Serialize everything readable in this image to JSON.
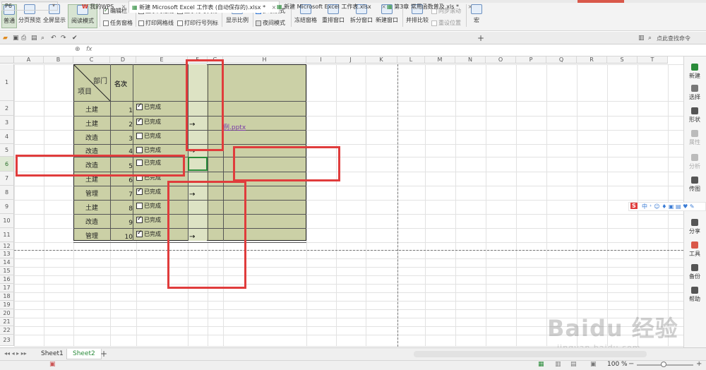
{
  "ribbon": {
    "buttons": {
      "normal": "普通",
      "page_preview": "分页预览",
      "fullscreen": "全屏显示",
      "read_mode": "阅读模式",
      "show_ratio": "显示比例",
      "freeze": "冻结窗格",
      "rearrange": "重排窗口",
      "split": "拆分窗口",
      "new_window": "新建窗口",
      "side_by_side": "并排比较",
      "macro": "宏"
    },
    "checks": {
      "edit_bar": {
        "label": "编辑栏",
        "checked": true
      },
      "task_pane": {
        "label": "任务窗格",
        "checked": false
      },
      "gridlines": {
        "label": "显示网格线",
        "checked": true
      },
      "print_gridlines": {
        "label": "打印网格线",
        "checked": false
      },
      "headers": {
        "label": "显示行号列标",
        "checked": true
      },
      "print_headers": {
        "label": "打印行号列标",
        "checked": false
      }
    },
    "eye_mode": "护眼模式",
    "night_mode": "夜间模式",
    "sync_scroll": "同步滚动",
    "reset_pos": "重设位置"
  },
  "tabs": {
    "my_wps": "我的WPS",
    "doc1": "新建 Microsoft Excel 工作表 (自动保存的).xlsx *",
    "doc2": "新建 Microsoft Excel 工作表.xlsx",
    "doc3": "第3章 常用函数普及.xls *",
    "search_hint": "点此查找命令"
  },
  "formula": {
    "cell": "P6",
    "fx": "fx"
  },
  "columns": [
    "A",
    "B",
    "C",
    "D",
    "E",
    "F",
    "G",
    "H",
    "I",
    "J",
    "K",
    "L",
    "M",
    "N",
    "O",
    "P",
    "Q",
    "R",
    "S",
    "T"
  ],
  "rows": [
    "1",
    "2",
    "3",
    "4",
    "5",
    "6",
    "7",
    "8",
    "9",
    "10",
    "11",
    "12",
    "13",
    "14",
    "15",
    "16",
    "17",
    "18",
    "19",
    "20",
    "21",
    "22",
    "23"
  ],
  "table": {
    "header_dept": "部门",
    "header_item": "项目",
    "header_rank": "名次",
    "rows": [
      {
        "project": "土建",
        "rank": "1",
        "status": "已完成",
        "done": true,
        "arrow": ""
      },
      {
        "project": "土建",
        "rank": "2",
        "status": "已完成",
        "done": true,
        "arrow": "→"
      },
      {
        "project": "改造",
        "rank": "3",
        "status": "已完成",
        "done": false,
        "arrow": ""
      },
      {
        "project": "改造",
        "rank": "4",
        "status": "已完成",
        "done": false,
        "arrow": "→"
      },
      {
        "project": "改造",
        "rank": "5",
        "status": "已完成",
        "done": false,
        "arrow": ""
      },
      {
        "project": "土建",
        "rank": "6",
        "status": "已完成",
        "done": false,
        "arrow": ""
      },
      {
        "project": "管理",
        "rank": "7",
        "status": "已完成",
        "done": true,
        "arrow": "→"
      },
      {
        "project": "土建",
        "rank": "8",
        "status": "已完成",
        "done": false,
        "arrow": ""
      },
      {
        "project": "改造",
        "rank": "9",
        "status": "已完成",
        "done": true,
        "arrow": ""
      },
      {
        "project": "管理",
        "rank": "10",
        "status": "已完成",
        "done": true,
        "arrow": "→"
      }
    ],
    "link_text": "例.pptx"
  },
  "right_panel": [
    "新建",
    "选择",
    "形状",
    "属性",
    "分析",
    "传图",
    "分享",
    "工具",
    "备份",
    "帮助"
  ],
  "sheets": [
    "Sheet1",
    "Sheet2"
  ],
  "zoom": "100 %",
  "watermark": {
    "brand": "Baidu 经验",
    "url": "jingyan.baidu.com"
  },
  "colors": {
    "table_bg": "#cbd0a6",
    "highlight_col": "#dde3c4",
    "annotation": "#e03c3c",
    "accent": "#2a8b3a"
  }
}
